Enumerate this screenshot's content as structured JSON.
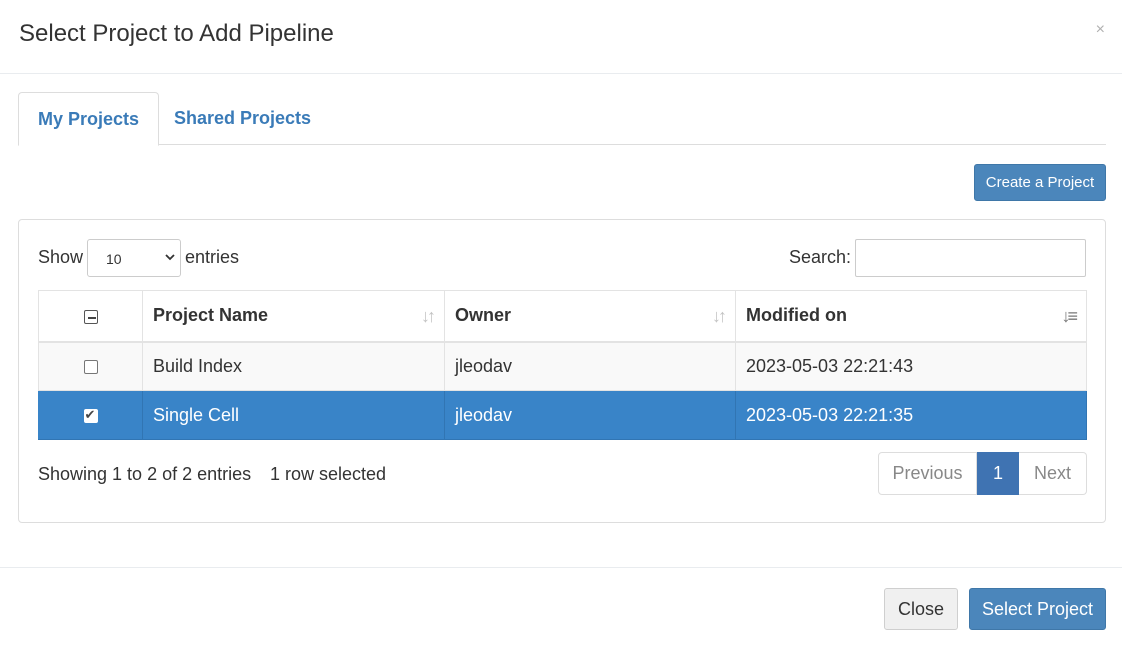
{
  "modal": {
    "title": "Select Project to Add Pipeline",
    "close_glyph": "×"
  },
  "tabs": [
    {
      "label": "My Projects",
      "active": true
    },
    {
      "label": "Shared Projects",
      "active": false
    }
  ],
  "toolbar": {
    "create_label": "Create a Project"
  },
  "table_controls": {
    "show_label": "Show",
    "page_length": "10",
    "entries_label": "entries",
    "search_label": "Search:",
    "search_value": "",
    "search_placeholder": ""
  },
  "table": {
    "columns": [
      "Project Name",
      "Owner",
      "Modified on"
    ],
    "rows": [
      {
        "name": "Build Index",
        "owner": "jleodav",
        "modified": "2023-05-03 22:21:43",
        "selected": false
      },
      {
        "name": "Single Cell",
        "owner": "jleodav",
        "modified": "2023-05-03 22:21:35",
        "selected": true
      }
    ]
  },
  "footer_info": {
    "showing": "Showing 1 to 2 of 2 entries",
    "selected": "1 row selected"
  },
  "pagination": {
    "previous": "Previous",
    "current": "1",
    "next": "Next"
  },
  "footer": {
    "close_label": "Close",
    "select_label": "Select Project"
  },
  "colors": {
    "primary": "#4b86bb",
    "selected_row": "#3984c8",
    "tab_text": "#3a7bb8"
  },
  "icons": {
    "sort_inactive": "sort-icon",
    "sort_desc": "sort-desc-icon",
    "close": "close-icon",
    "select_chevron": "chevron-down-icon"
  }
}
